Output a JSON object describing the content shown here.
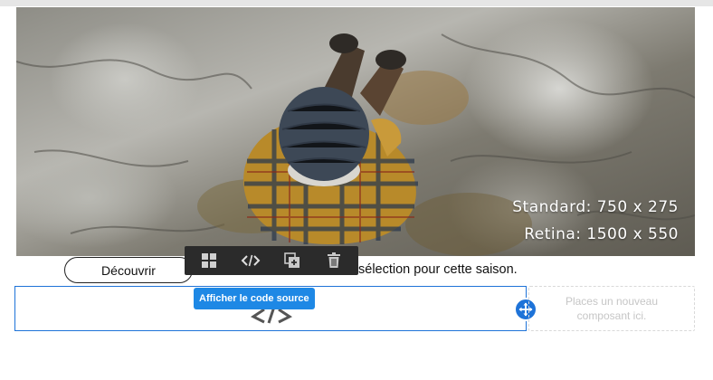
{
  "hero": {
    "caption_standard": "Standard: 750 x 275",
    "caption_retina": "Retina: 1500 x 550"
  },
  "cta": {
    "label": "Découvrir"
  },
  "body_text": "sélection pour cette saison.",
  "toolbar": {
    "tools": [
      {
        "icon": "layout-icon"
      },
      {
        "icon": "code-icon"
      },
      {
        "icon": "duplicate-icon"
      },
      {
        "icon": "trash-icon"
      }
    ],
    "tooltip": "Afficher le code source"
  },
  "placeholder": {
    "text": "Places un nouveau composant ici."
  },
  "colors": {
    "accent": "#1e73d8",
    "tooltip_bg": "#1e88e5",
    "toolbar_bg": "#2b2b2b"
  }
}
